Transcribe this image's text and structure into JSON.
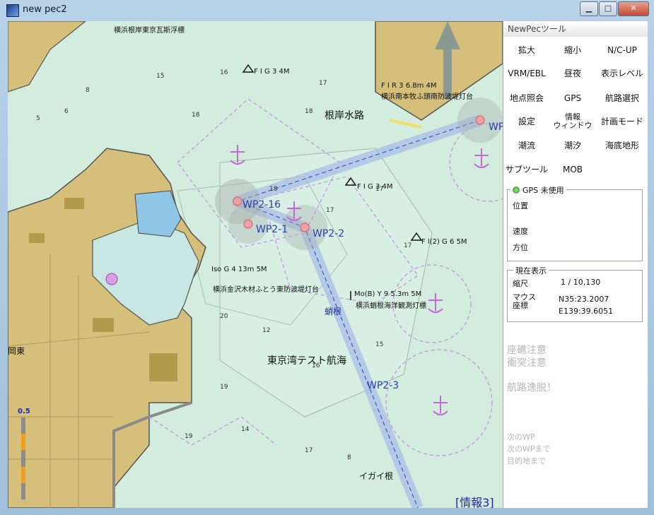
{
  "window": {
    "title": "new pec2",
    "minimize": "▁",
    "maximize": "□",
    "close": "✕"
  },
  "panel": {
    "title": "NewPecツール",
    "buttons": [
      {
        "label": "拡大"
      },
      {
        "label": "縮小"
      },
      {
        "label": "N/C-UP"
      },
      {
        "label": "VRM/EBL"
      },
      {
        "label": "昼夜"
      },
      {
        "label": "表示レベル"
      },
      {
        "label": "地点照会"
      },
      {
        "label": "GPS"
      },
      {
        "label": "航路選択"
      },
      {
        "label": "設定"
      },
      {
        "label": "情報\nウィンドウ"
      },
      {
        "label": "計画モード"
      },
      {
        "label": "潮流"
      },
      {
        "label": "潮汐"
      },
      {
        "label": "海底地形"
      },
      {
        "label": "サブツール"
      },
      {
        "label": "MOB"
      }
    ],
    "gps": {
      "status": "GPS 未使用",
      "position_label": "位置",
      "speed_label": "速度",
      "heading_label": "方位"
    },
    "current": {
      "legend": "現在表示",
      "scale_label": "縮尺",
      "scale_value": "1 / 10,130",
      "mouse_label": "マウス\n座標",
      "lat": "N35:23.2007",
      "lon": "E139:39.6051"
    },
    "warnings": [
      "座礁注意",
      "衝突注意",
      "航路逸脱！"
    ],
    "next": [
      "次のWP",
      "次のWPまで",
      "目的地まで"
    ]
  },
  "map": {
    "info_link": "[情報3]",
    "route_name": "東京湾テスト航海",
    "channel": "根岸水路",
    "waypoints": [
      "WP2-16",
      "WP2-1",
      "WP2-2",
      "WP2-3",
      "WP"
    ],
    "labels": [
      "横浜根岸東京瓦斯浮標",
      "F I G 3 4M",
      "F I R 3 6.8m 4M",
      "横浜南本牧ふ頭南防波堤灯台",
      "F I G 3 4M",
      "F l(2) G 6 5M",
      "Iso G 4 13m 5M",
      "横浜金沢木材ふとう東防波堤灯台",
      "Mo(B) Y 9 5.3m 5M",
      "横浜蛸根海洋観測灯標",
      "蛸根",
      "イガイ根",
      "岡東"
    ],
    "scale_bar_value": "0.5",
    "colors": {
      "sea": "#d2ecde",
      "land": "#d6bf7a",
      "route": "#a9bde6",
      "wp": "#e07a7a"
    }
  }
}
